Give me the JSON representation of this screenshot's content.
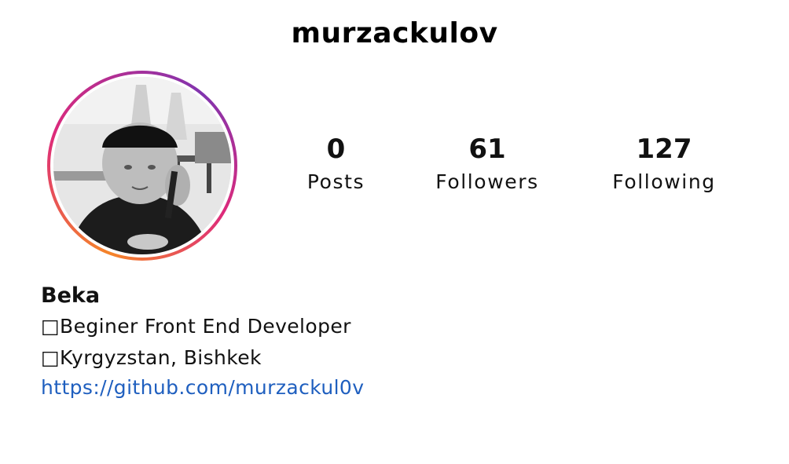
{
  "profile": {
    "username": "murzackulov",
    "avatar_icon": "profile-photo",
    "ring_colors": [
      "#f58529",
      "#dd2a7b",
      "#8134af"
    ]
  },
  "stats": {
    "posts": {
      "value": "0",
      "label": "Posts"
    },
    "followers": {
      "value": "61",
      "label": "Followers"
    },
    "following": {
      "value": "127",
      "label": "Following"
    }
  },
  "bio": {
    "name": "Beka",
    "lines": [
      "□Beginer Front End Developer",
      "□Kyrgyzstan, Bishkek"
    ],
    "link": "https://github.com/murzackul0v",
    "link_color": "#1f5fbf"
  }
}
